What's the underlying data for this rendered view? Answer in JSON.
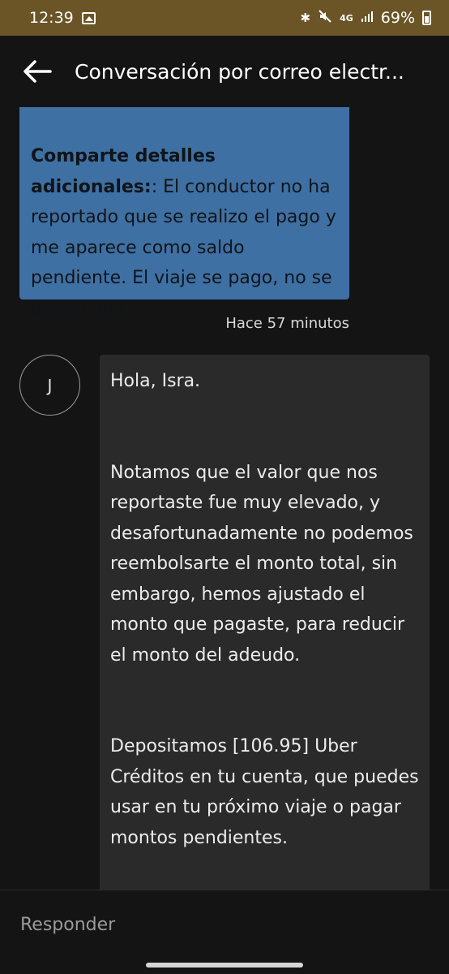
{
  "status_bar": {
    "time": "12:39",
    "battery": "69%",
    "network": "4G"
  },
  "header": {
    "title": "Conversación por correo electr..."
  },
  "messages": {
    "sent": {
      "label": "Comparte detalles adicionales:",
      "text": ": El conductor no ha reportado que se realizo el pago y me aparece como saldo pendiente. El viaje se pago, no se debe nada",
      "time": "Hace 57 minutos"
    },
    "received": {
      "avatar_initial": "J",
      "greeting": "Hola, Isra.",
      "paragraph1": "Notamos que el valor que nos reportaste fue muy elevado, y desafortunadamente no podemos reembolsarte el monto total, sin embargo, hemos ajustado el monto que pagaste, para reducir el monto del adeudo.",
      "paragraph2": "Depositamos [106.95] Uber Créditos en tu cuenta, que puedes usar en tu próximo viaje o pagar montos pendientes."
    }
  },
  "reply": {
    "placeholder": "Responder"
  },
  "colors": {
    "status_bar": "#6b5527",
    "sent_bubble": "#3f70a3",
    "received_bubble": "#2a2a2a",
    "background": "#141414"
  }
}
